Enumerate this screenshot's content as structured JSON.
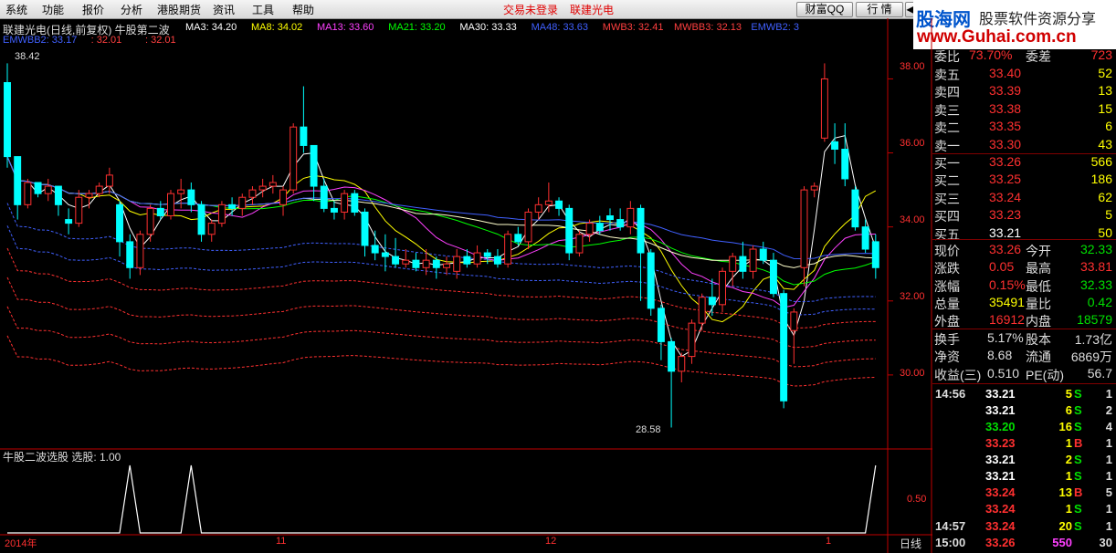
{
  "menu": {
    "items": [
      "系统",
      "功能",
      "报价",
      "分析",
      "港股期货",
      "资讯",
      "工具",
      "帮助"
    ],
    "status": "交易未登录",
    "stock_name": "联建光电",
    "btn_caifu": "财富QQ",
    "btn_hangqing": "行 情",
    "btn_arrow": "◀"
  },
  "logo": {
    "brand": "股海网",
    "tagline": "股票软件资源分享",
    "url": "www.Guhai.com.cn"
  },
  "chart": {
    "title": "联建光电(日线,前复权) 牛股第二波",
    "ma": [
      {
        "label": "MA3: 34.20",
        "color": "#ffffff"
      },
      {
        "label": "MA8: 34.02",
        "color": "#ffff00"
      },
      {
        "label": "MA13: 33.60",
        "color": "#ff40ff"
      },
      {
        "label": "MA21: 33.20",
        "color": "#00ff00"
      },
      {
        "label": "MA30: 33.33",
        "color": "#ffffff"
      },
      {
        "label": "MA48: 33.63",
        "color": "#4060ff"
      },
      {
        "label": "MWB3: 32.41",
        "color": "#ff4040"
      },
      {
        "label": "MWBB3: 32.13",
        "color": "#ff4040"
      },
      {
        "label": "EMWB2: 3",
        "color": "#4060ff"
      }
    ],
    "line2": [
      {
        "label": "EMWBB2: 33.17",
        "color": "#4060ff"
      },
      {
        "label": ": 32.01",
        "color": "#ff4040"
      },
      {
        "label": ": 32.01",
        "color": "#ff4040"
      }
    ],
    "high_label": "38.42",
    "low_label": "28.58",
    "price_axis": [
      "38.00",
      "36.00",
      "34.00",
      "32.00",
      "30.00"
    ],
    "indicator_title": "牛股二波选股  选股: 1.00",
    "indicator_axis": "0.50",
    "date_labels": [
      "2014年",
      "11",
      "12",
      "1"
    ],
    "period": "日线",
    "colors": {
      "up": "#ff3030",
      "down": "#00ffff",
      "axis": "#c00000"
    }
  },
  "quote": {
    "weibi": {
      "label": "委比",
      "value": "73.70%",
      "label2": "委差",
      "value2": "723"
    },
    "asks": [
      {
        "label": "卖五",
        "price": "33.40",
        "vol": "52"
      },
      {
        "label": "卖四",
        "price": "33.39",
        "vol": "13"
      },
      {
        "label": "卖三",
        "price": "33.38",
        "vol": "15"
      },
      {
        "label": "卖二",
        "price": "33.35",
        "vol": "6"
      },
      {
        "label": "卖一",
        "price": "33.30",
        "vol": "43"
      }
    ],
    "bids": [
      {
        "label": "买一",
        "price": "33.26",
        "vol": "566"
      },
      {
        "label": "买二",
        "price": "33.25",
        "vol": "186"
      },
      {
        "label": "买三",
        "price": "33.24",
        "vol": "62"
      },
      {
        "label": "买四",
        "price": "33.23",
        "vol": "5"
      },
      {
        "label": "买五",
        "price": "33.21",
        "vol": "50"
      }
    ],
    "stats": [
      {
        "l1": "现价",
        "v1": "33.26",
        "c1": "#ff3030",
        "l2": "今开",
        "v2": "32.33",
        "c2": "#00e000"
      },
      {
        "l1": "涨跌",
        "v1": "0.05",
        "c1": "#ff3030",
        "l2": "最高",
        "v2": "33.81",
        "c2": "#ff3030"
      },
      {
        "l1": "涨幅",
        "v1": "0.15%",
        "c1": "#ff3030",
        "l2": "最低",
        "v2": "32.33",
        "c2": "#00e000"
      },
      {
        "l1": "总量",
        "v1": "35491",
        "c1": "#ffff00",
        "l2": "量比",
        "v2": "0.42",
        "c2": "#00e000"
      },
      {
        "l1": "外盘",
        "v1": "16912",
        "c1": "#ff3030",
        "l2": "内盘",
        "v2": "18579",
        "c2": "#00e000"
      }
    ],
    "stats2": [
      {
        "l1": "换手",
        "v1": "5.17%",
        "l2": "股本",
        "v2": "1.73亿"
      },
      {
        "l1": "净资",
        "v1": "8.68",
        "l2": "流通",
        "v2": "6869万"
      },
      {
        "l1": "收益(三)",
        "v1": "0.510",
        "l2": "PE(动)",
        "v2": "56.7"
      }
    ],
    "ticks": [
      {
        "time": "14:56",
        "price": "33.21",
        "pc": "#ffffff",
        "vol": "5",
        "vc": "#ffff00",
        "side": "S",
        "sc": "#00e000",
        "n": "1"
      },
      {
        "time": "",
        "price": "33.21",
        "pc": "#ffffff",
        "vol": "6",
        "vc": "#ffff00",
        "side": "S",
        "sc": "#00e000",
        "n": "2"
      },
      {
        "time": "",
        "price": "33.20",
        "pc": "#00e000",
        "vol": "16",
        "vc": "#ffff00",
        "side": "S",
        "sc": "#00e000",
        "n": "4"
      },
      {
        "time": "",
        "price": "33.23",
        "pc": "#ff3030",
        "vol": "1",
        "vc": "#ffff00",
        "side": "B",
        "sc": "#ff3030",
        "n": "1"
      },
      {
        "time": "",
        "price": "33.21",
        "pc": "#ffffff",
        "vol": "2",
        "vc": "#ffff00",
        "side": "S",
        "sc": "#00e000",
        "n": "1"
      },
      {
        "time": "",
        "price": "33.21",
        "pc": "#ffffff",
        "vol": "1",
        "vc": "#ffff00",
        "side": "S",
        "sc": "#00e000",
        "n": "1"
      },
      {
        "time": "",
        "price": "33.24",
        "pc": "#ff3030",
        "vol": "13",
        "vc": "#ffff00",
        "side": "B",
        "sc": "#ff3030",
        "n": "5"
      },
      {
        "time": "",
        "price": "33.24",
        "pc": "#ff3030",
        "vol": "1",
        "vc": "#ffff00",
        "side": "S",
        "sc": "#00e000",
        "n": "1"
      },
      {
        "time": "14:57",
        "price": "33.24",
        "pc": "#ff3030",
        "vol": "20",
        "vc": "#ffff00",
        "side": "S",
        "sc": "#00e000",
        "n": "1"
      },
      {
        "time": "15:00",
        "price": "33.26",
        "pc": "#ff3030",
        "vol": "550",
        "vc": "#ff40ff",
        "side": "",
        "sc": "#00e000",
        "n": "30"
      }
    ]
  },
  "chart_data": {
    "type": "candlestick",
    "ylim": [
      28.0,
      38.8
    ],
    "grid": false,
    "candles": [
      [
        37.9,
        38.42,
        35.6,
        35.9
      ],
      [
        35.9,
        35.9,
        34.2,
        34.6
      ],
      [
        34.6,
        35.3,
        34.5,
        35.2
      ],
      [
        35.2,
        35.2,
        34.8,
        34.9
      ],
      [
        34.9,
        35.3,
        34.7,
        35.1
      ],
      [
        35.1,
        35.1,
        34.3,
        34.6
      ],
      [
        34.2,
        34.5,
        33.8,
        34.1
      ],
      [
        34.1,
        35.0,
        34.0,
        34.8
      ],
      [
        34.8,
        35.0,
        34.5,
        34.9
      ],
      [
        34.9,
        35.2,
        34.8,
        35.1
      ],
      [
        35.1,
        35.6,
        34.9,
        35.4
      ],
      [
        34.6,
        34.7,
        33.2,
        33.6
      ],
      [
        33.6,
        33.8,
        32.6,
        32.9
      ],
      [
        32.9,
        33.9,
        32.7,
        33.8
      ],
      [
        33.8,
        34.6,
        33.6,
        34.5
      ],
      [
        34.5,
        34.7,
        34.2,
        34.3
      ],
      [
        34.3,
        35.0,
        34.2,
        34.9
      ],
      [
        34.9,
        35.3,
        34.5,
        35.0
      ],
      [
        35.0,
        35.2,
        34.4,
        34.6
      ],
      [
        34.6,
        34.7,
        33.6,
        33.8
      ],
      [
        33.8,
        34.2,
        33.6,
        34.1
      ],
      [
        34.1,
        34.7,
        34.0,
        34.6
      ],
      [
        34.6,
        34.8,
        34.3,
        34.5
      ],
      [
        34.5,
        34.9,
        34.3,
        34.8
      ],
      [
        34.8,
        35.1,
        34.6,
        35.0
      ],
      [
        35.0,
        35.3,
        34.8,
        35.1
      ],
      [
        35.1,
        35.4,
        34.9,
        35.2
      ],
      [
        34.6,
        35.1,
        34.3,
        35.0
      ],
      [
        35.0,
        36.8,
        34.9,
        36.7
      ],
      [
        36.7,
        37.8,
        36.0,
        36.2
      ],
      [
        36.2,
        36.2,
        34.7,
        35.1
      ],
      [
        35.1,
        35.3,
        34.4,
        34.5
      ],
      [
        34.5,
        34.7,
        34.2,
        34.4
      ],
      [
        34.4,
        35.0,
        34.2,
        34.9
      ],
      [
        34.9,
        35.0,
        34.3,
        34.4
      ],
      [
        34.4,
        34.5,
        33.2,
        33.5
      ],
      [
        33.5,
        33.9,
        33.1,
        33.3
      ],
      [
        33.3,
        33.8,
        32.8,
        33.2
      ],
      [
        33.2,
        33.7,
        32.9,
        33.0
      ],
      [
        33.0,
        33.4,
        32.9,
        33.1
      ],
      [
        33.1,
        33.3,
        32.8,
        32.9
      ],
      [
        32.9,
        33.4,
        32.7,
        33.1
      ],
      [
        33.1,
        33.2,
        32.6,
        32.9
      ],
      [
        32.9,
        33.2,
        32.7,
        33.0
      ],
      [
        32.8,
        33.4,
        32.6,
        33.2
      ],
      [
        33.2,
        33.4,
        32.9,
        33.0
      ],
      [
        33.0,
        33.5,
        32.9,
        33.3
      ],
      [
        33.3,
        33.4,
        33.0,
        33.2
      ],
      [
        33.2,
        33.4,
        32.9,
        33.0
      ],
      [
        33.0,
        33.9,
        32.9,
        33.8
      ],
      [
        33.8,
        34.0,
        33.5,
        33.6
      ],
      [
        33.6,
        34.5,
        33.4,
        34.4
      ],
      [
        34.4,
        34.8,
        34.2,
        34.6
      ],
      [
        34.6,
        35.2,
        34.4,
        34.7
      ],
      [
        34.7,
        34.8,
        34.3,
        34.5
      ],
      [
        34.5,
        34.6,
        33.1,
        33.3
      ],
      [
        33.3,
        33.9,
        33.2,
        33.8
      ],
      [
        33.8,
        34.2,
        33.6,
        34.1
      ],
      [
        34.1,
        34.3,
        33.8,
        33.9
      ],
      [
        34.3,
        34.5,
        33.9,
        34.2
      ],
      [
        34.2,
        34.5,
        33.9,
        34.0
      ],
      [
        34.0,
        34.7,
        33.8,
        34.5
      ],
      [
        34.5,
        34.6,
        32.0,
        33.3
      ],
      [
        33.3,
        33.4,
        31.6,
        31.8
      ],
      [
        31.8,
        31.9,
        30.4,
        30.9
      ],
      [
        30.9,
        31.0,
        28.58,
        30.1
      ],
      [
        30.1,
        30.6,
        29.8,
        30.5
      ],
      [
        30.5,
        31.5,
        30.3,
        31.4
      ],
      [
        31.4,
        32.2,
        31.2,
        32.1
      ],
      [
        32.1,
        32.6,
        31.6,
        31.9
      ],
      [
        31.9,
        32.9,
        31.7,
        32.8
      ],
      [
        32.8,
        33.3,
        32.4,
        33.2
      ],
      [
        33.2,
        33.6,
        32.6,
        32.8
      ],
      [
        32.8,
        33.5,
        32.6,
        33.4
      ],
      [
        33.4,
        33.6,
        33.0,
        33.1
      ],
      [
        33.1,
        33.3,
        32.1,
        32.2
      ],
      [
        32.2,
        32.3,
        29.1,
        29.3
      ],
      [
        31.2,
        31.8,
        30.3,
        31.7
      ],
      [
        32.9,
        35.1,
        32.4,
        35.0
      ],
      [
        35.0,
        35.2,
        34.8,
        35.1
      ],
      [
        36.4,
        38.42,
        36.3,
        38.0
      ],
      [
        36.3,
        36.8,
        35.7,
        36.1
      ],
      [
        36.1,
        36.8,
        35.1,
        35.3
      ],
      [
        35.0,
        35.1,
        33.9,
        34.0
      ],
      [
        34.0,
        34.2,
        33.3,
        33.4
      ],
      [
        33.6,
        33.8,
        32.6,
        32.9
      ]
    ],
    "indicator_signals": [
      0,
      0,
      0,
      0,
      0,
      0,
      0,
      0,
      0,
      0,
      0,
      0,
      1,
      0,
      0,
      0,
      0,
      0,
      1,
      0,
      0,
      0,
      0,
      0,
      0,
      0,
      0,
      0,
      0,
      0,
      0,
      0,
      0,
      0,
      0,
      0,
      0,
      0,
      0,
      0,
      0,
      0,
      0,
      0,
      0,
      0,
      0,
      0,
      0,
      0,
      0,
      0,
      0,
      0,
      0,
      0,
      0,
      0,
      0,
      0,
      0,
      0,
      0,
      0,
      0,
      0,
      0,
      0,
      0,
      0,
      0,
      0,
      0,
      0,
      0,
      0,
      0,
      0,
      0,
      0,
      0,
      0,
      0,
      0,
      0,
      1
    ]
  }
}
